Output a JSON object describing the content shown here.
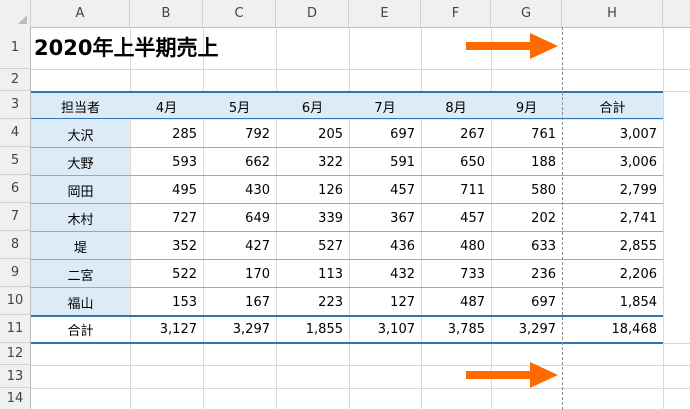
{
  "columns": [
    "A",
    "B",
    "C",
    "D",
    "E",
    "F",
    "G",
    "H"
  ],
  "rows": [
    "1",
    "2",
    "3",
    "4",
    "5",
    "6",
    "7",
    "8",
    "9",
    "10",
    "11",
    "12",
    "13",
    "14"
  ],
  "title": "2020年上半期売上",
  "table": {
    "headers": [
      "担当者",
      "4月",
      "5月",
      "6月",
      "7月",
      "8月",
      "9月",
      "合計"
    ],
    "rows": [
      {
        "name": "大沢",
        "values": [
          "285",
          "792",
          "205",
          "697",
          "267",
          "761"
        ],
        "total": "3,007"
      },
      {
        "name": "大野",
        "values": [
          "593",
          "662",
          "322",
          "591",
          "650",
          "188"
        ],
        "total": "3,006"
      },
      {
        "name": "岡田",
        "values": [
          "495",
          "430",
          "126",
          "457",
          "711",
          "580"
        ],
        "total": "2,799"
      },
      {
        "name": "木村",
        "values": [
          "727",
          "649",
          "339",
          "367",
          "457",
          "202"
        ],
        "total": "2,741"
      },
      {
        "name": "堤",
        "values": [
          "352",
          "427",
          "527",
          "436",
          "480",
          "633"
        ],
        "total": "2,855"
      },
      {
        "name": "二宮",
        "values": [
          "522",
          "170",
          "113",
          "432",
          "733",
          "236"
        ],
        "total": "2,206"
      },
      {
        "name": "福山",
        "values": [
          "153",
          "167",
          "223",
          "127",
          "487",
          "697"
        ],
        "total": "1,854"
      }
    ],
    "total_row": {
      "name": "合計",
      "values": [
        "3,127",
        "3,297",
        "1,855",
        "3,107",
        "3,785",
        "3,297"
      ],
      "total": "18,468"
    }
  },
  "colors": {
    "header_fill": "#ddebf7",
    "name_fill": "#ddebf7",
    "border_blue": "#2e75b6",
    "arrow": "#ff6a00"
  }
}
